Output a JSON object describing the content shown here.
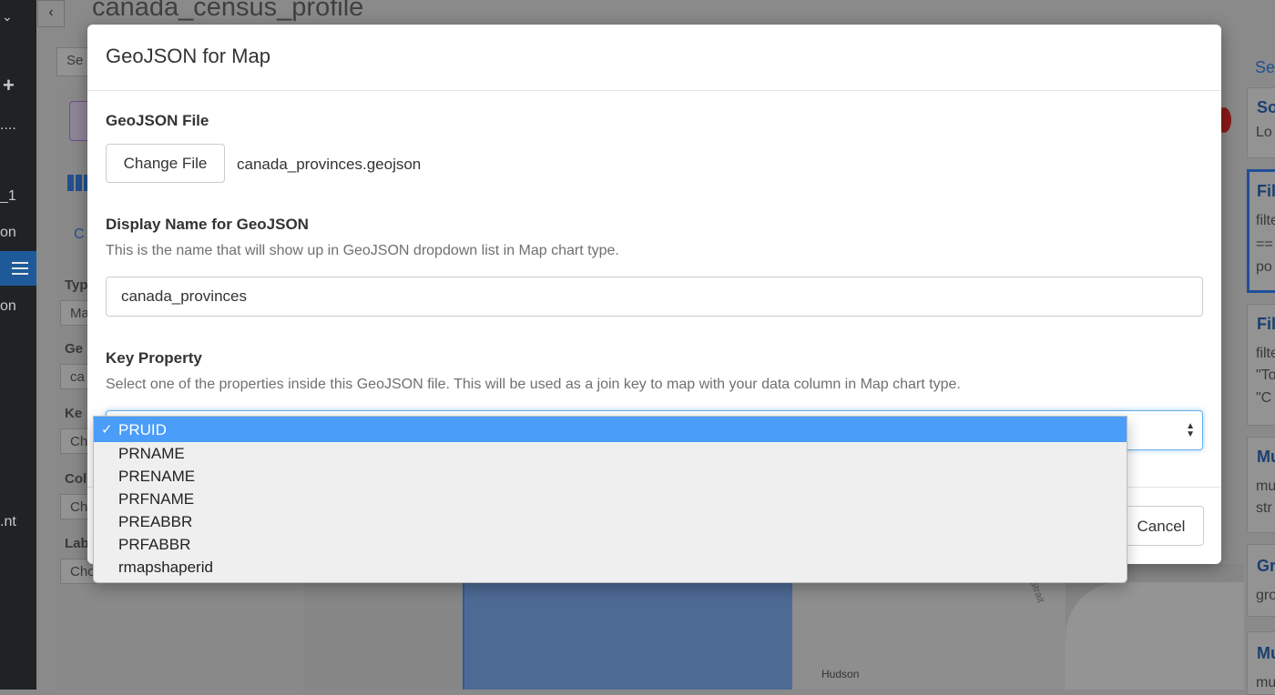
{
  "background": {
    "page_title": "canada_census_profile",
    "back_button": "‹",
    "left_rail": [
      "+",
      "....",
      "_1",
      "on",
      "on",
      ".nt"
    ],
    "left_panel": {
      "select_button": "Se",
      "tab": "C",
      "labels": [
        "Typ",
        "Ge",
        "Ke",
        "Col",
        "Lab"
      ],
      "boxes": [
        "Ma",
        "ca",
        "Ch",
        "Ch",
        "Cho"
      ]
    },
    "right_panel": {
      "top_link": "Se",
      "cards": [
        {
          "title": "So",
          "text": "Lo"
        },
        {
          "title": "Fil",
          "text": "filte"
        },
        {
          "title": "Fil",
          "text": "filte"
        },
        {
          "title": "Mu",
          "text": "mu"
        },
        {
          "title": "Gr",
          "text": "gro"
        },
        {
          "title": "Mu",
          "text": "mu"
        }
      ],
      "extra_lines": [
        "==",
        "po",
        "\"To",
        "\"C",
        "str"
      ]
    },
    "map_labels": {
      "hudson": "Hudson",
      "strait": "s Strait"
    }
  },
  "modal": {
    "title": "GeoJSON for Map",
    "geojson_file": {
      "label": "GeoJSON File",
      "change_button": "Change File",
      "file_name": "canada_provinces.geojson"
    },
    "display_name": {
      "label": "Display Name for GeoJSON",
      "help": "This is the name that will show up in GeoJSON dropdown list in Map chart type.",
      "value": "canada_provinces"
    },
    "key_property": {
      "label": "Key Property",
      "help": "Select one of the properties inside this GeoJSON file. This will be used as a join key to map with your data column in Map chart type.",
      "selected": "PRUID",
      "options": [
        "PRUID",
        "PRNAME",
        "PRENAME",
        "PRFNAME",
        "PREABBR",
        "PRFABBR",
        "rmapshaperid"
      ],
      "check_mark": "✓"
    },
    "cancel_button": "Cancel"
  }
}
